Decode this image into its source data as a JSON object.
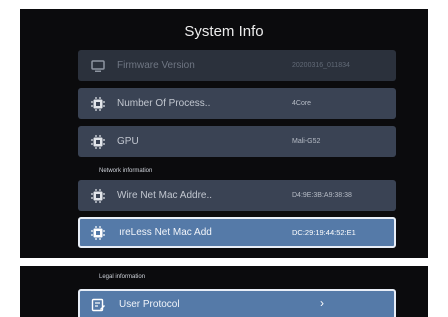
{
  "title": "System Info",
  "rows": [
    {
      "label": "Firmware Version",
      "value": "20200316_011834"
    },
    {
      "label": "Number Of Process..",
      "value": "4Core"
    },
    {
      "label": "GPU",
      "value": "Mali-G52"
    },
    {
      "label": "Wire Net Mac Addre..",
      "value": "D4:9E:3B:A9:38:38"
    },
    {
      "label": "ıreLess Net Mac Add",
      "value": "DC:29:19:44:52:E1"
    }
  ],
  "sections": {
    "network": "Network information",
    "legal": "Legal information"
  },
  "legal_rows": [
    {
      "label": "User Protocol",
      "chevron": "›"
    }
  ],
  "icons": {
    "firmware": "monitor-icon",
    "processors": "chip-icon",
    "gpu": "chip-icon",
    "wired": "chip-icon",
    "wireless": "chip-icon",
    "protocol": "document-edit-icon"
  },
  "colors": {
    "background": "#0b0b0d",
    "row": "#3a4354",
    "selected": "#557aa8",
    "selected_border": "#e8eef7"
  }
}
